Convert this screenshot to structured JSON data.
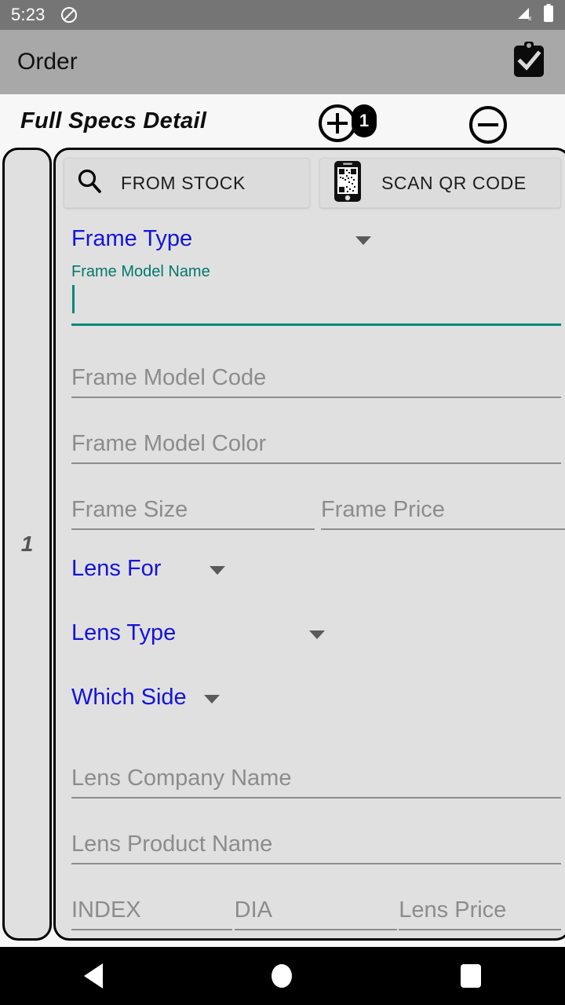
{
  "status_bar": {
    "time": "5:23",
    "left_icon": "do-not-disturb-icon",
    "signal_icon": "signal-no-sim-icon",
    "battery_icon": "battery-full-icon"
  },
  "app_bar": {
    "title": "Order",
    "action_icon": "clipboard-check-icon"
  },
  "sub_header": {
    "title": "Full Specs Detail",
    "add_icon": "plus-circle-icon",
    "add_badge": "1",
    "remove_icon": "minus-circle-icon"
  },
  "left_panel": {
    "index": "1"
  },
  "actions": {
    "from_stock": {
      "label": "FROM STOCK",
      "icon": "search-icon"
    },
    "scan_qr": {
      "label": "SCAN QR CODE",
      "icon": "phone-qr-icon"
    }
  },
  "form": {
    "frame_type": {
      "label": "Frame Type",
      "type": "dropdown",
      "value": ""
    },
    "frame_model_name": {
      "label": "Frame Model Name",
      "value": "",
      "focused": true
    },
    "frame_model_code": {
      "placeholder": "Frame Model Code",
      "value": ""
    },
    "frame_model_color": {
      "placeholder": "Frame Model Color",
      "value": ""
    },
    "frame_size": {
      "placeholder": "Frame Size",
      "value": ""
    },
    "frame_price": {
      "placeholder": "Frame Price",
      "value": ""
    },
    "lens_for": {
      "label": "Lens For",
      "type": "dropdown",
      "value": ""
    },
    "lens_type": {
      "label": "Lens Type",
      "type": "dropdown",
      "value": ""
    },
    "which_side": {
      "label": "Which Side",
      "type": "dropdown",
      "value": ""
    },
    "lens_company_name": {
      "placeholder": "Lens Company Name",
      "value": ""
    },
    "lens_product_name": {
      "placeholder": "Lens Product Name",
      "value": ""
    },
    "index": {
      "placeholder": "INDEX",
      "value": ""
    },
    "dia": {
      "placeholder": "DIA",
      "value": ""
    },
    "lens_price": {
      "placeholder": "Lens Price",
      "value": ""
    }
  },
  "nav_bar": {
    "back": "back-icon",
    "home": "home-icon",
    "recents": "recents-icon"
  },
  "colors": {
    "accent_teal": "#00897B",
    "dropdown_blue": "#1414d8",
    "status_bar": "#757575",
    "app_bar": "#a8a8a8",
    "card_bg": "#e0e0e0"
  }
}
